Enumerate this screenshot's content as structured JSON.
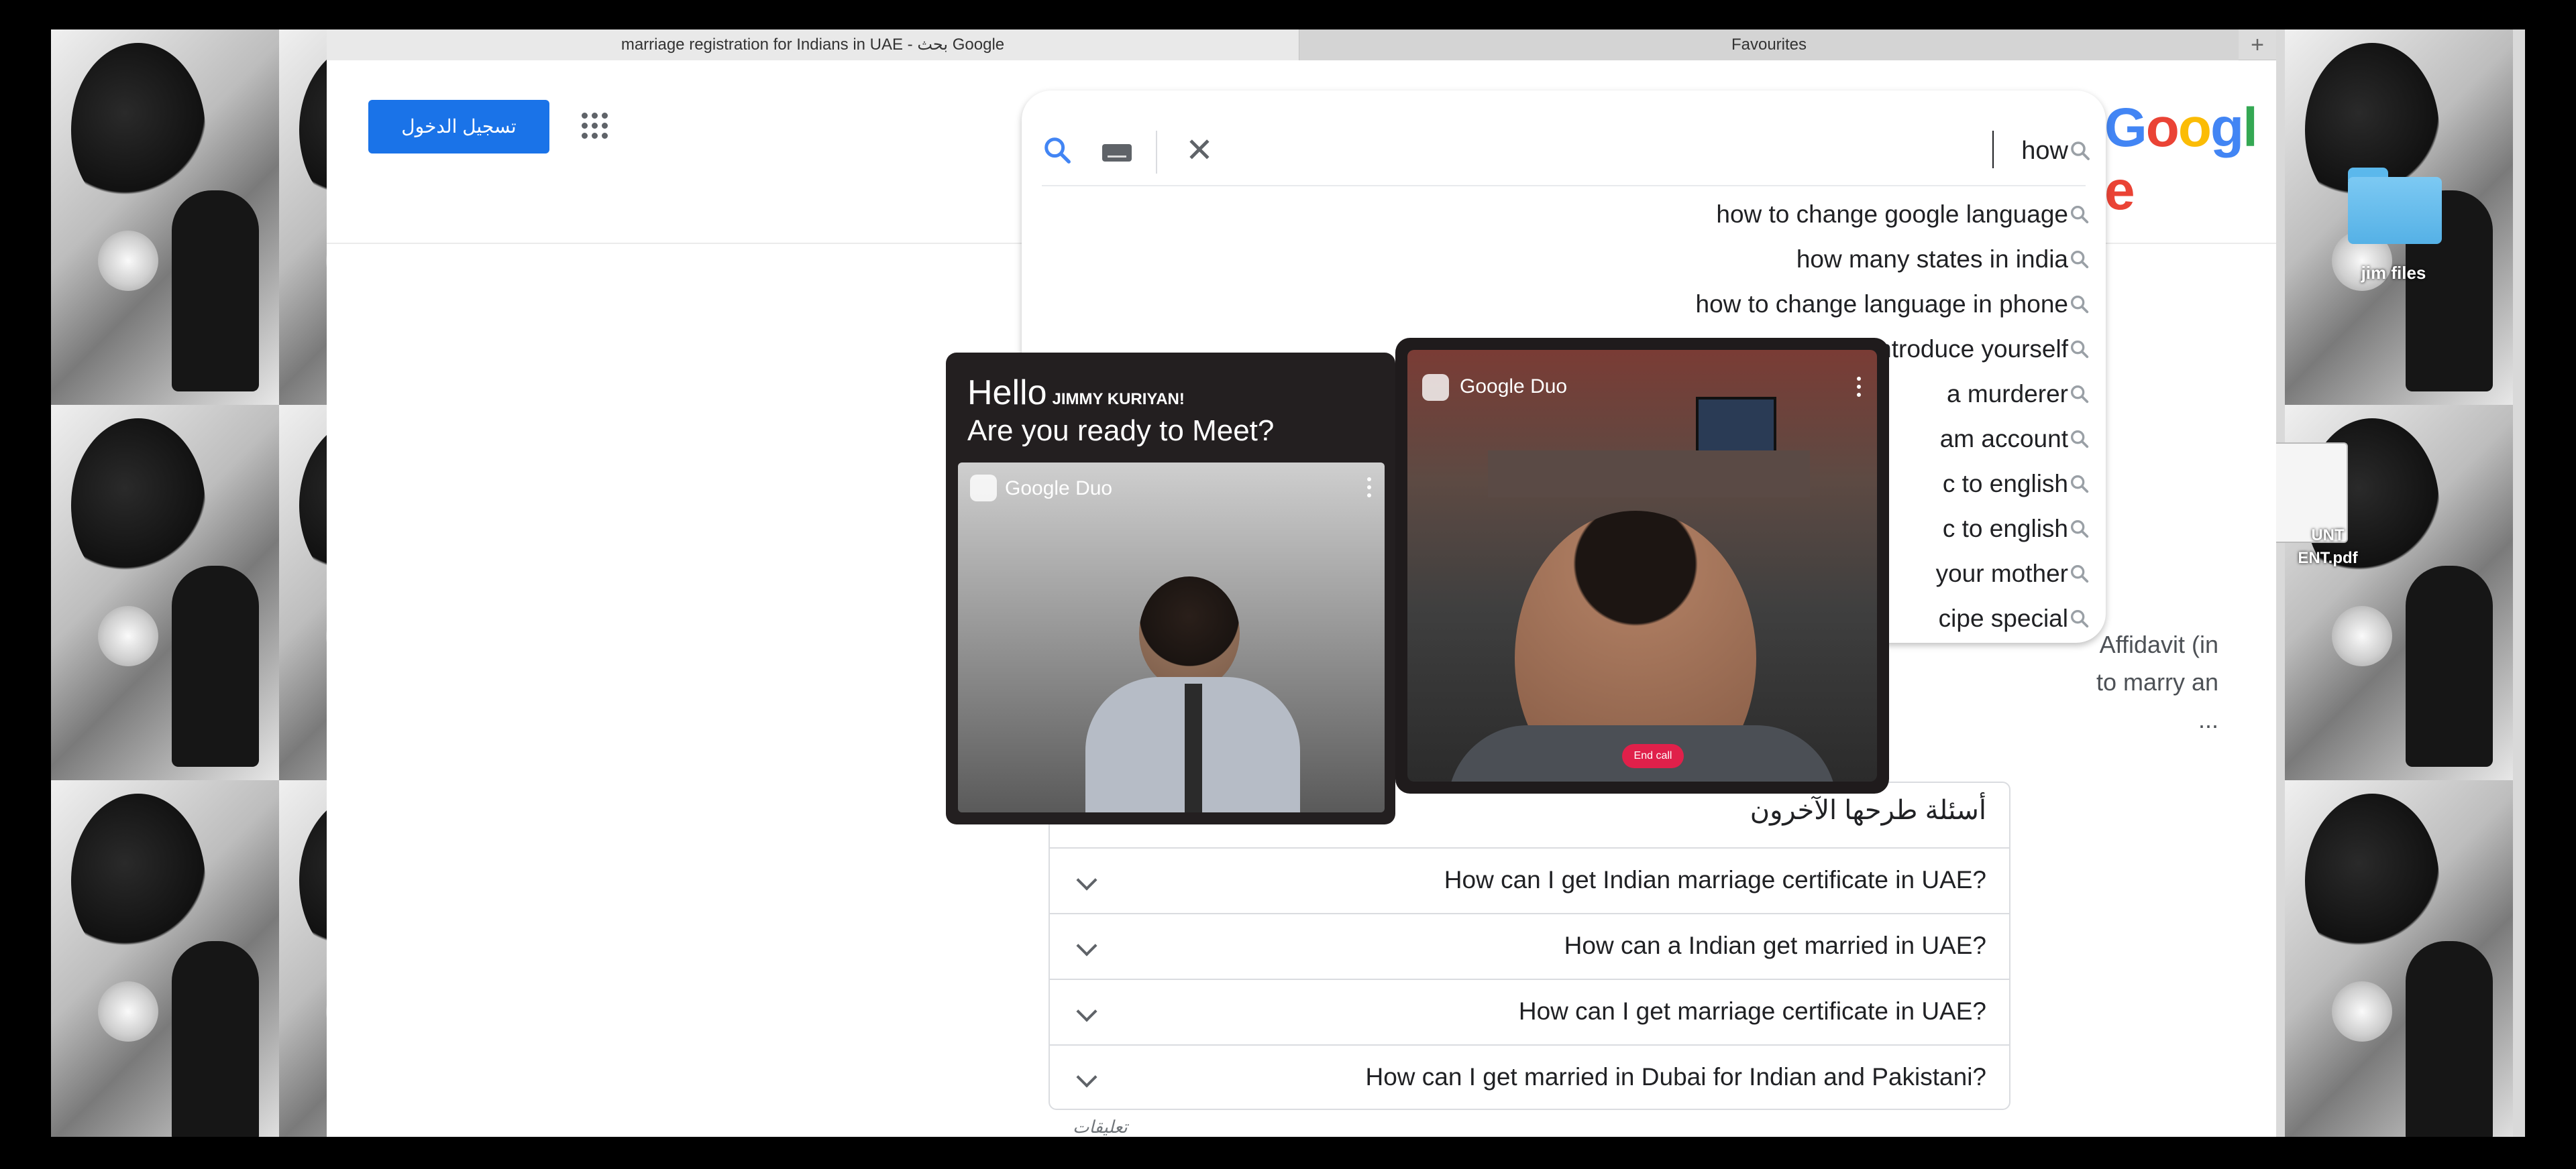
{
  "browser": {
    "tabs": [
      {
        "label": "marriage registration for Indians in UAE - بحث Google"
      },
      {
        "label": "Favourites"
      }
    ],
    "new_tab_symbol": "+"
  },
  "desktop": {
    "folder_label": "jim files",
    "pdf_label_line1": "UNT",
    "pdf_label_line2": "ENT.pdf"
  },
  "header": {
    "signin_label": "تسجيل الدخول",
    "logo_text": "Google",
    "logo_colors": [
      "#4285F4",
      "#EA4335",
      "#FBBC05",
      "#4285F4",
      "#34A853",
      "#EA4335"
    ]
  },
  "search": {
    "query": "how",
    "suggestions": [
      "how to change google language",
      "how many states in india",
      "how to change language in phone",
      "how to introduce yourself",
      "a murderer",
      "am account",
      "c to english",
      "c to english",
      "your mother",
      "cipe special"
    ]
  },
  "results": {
    "snippet_lines": [
      "Affidavit (in",
      "to marry an",
      "..."
    ],
    "paa_title": "أسئلة طرحها الآخرون",
    "paa_questions": [
      "How can I get Indian marriage certificate in UAE?",
      "How can a Indian get married in UAE?",
      "How can I get marriage certificate in UAE?",
      "How can I get married in Dubai for Indian and Pakistani?"
    ],
    "feedback_label": "تعليقات"
  },
  "duo": {
    "hello": "Hello",
    "name": "JIMMY KURIYAN!",
    "question": "Are you ready to Meet?",
    "brand": "Google Duo",
    "end_call": "End call"
  },
  "colors": {
    "accent_blue": "#1a73e8",
    "end_call_red": "#e0204a",
    "card_dark": "#231f20"
  }
}
